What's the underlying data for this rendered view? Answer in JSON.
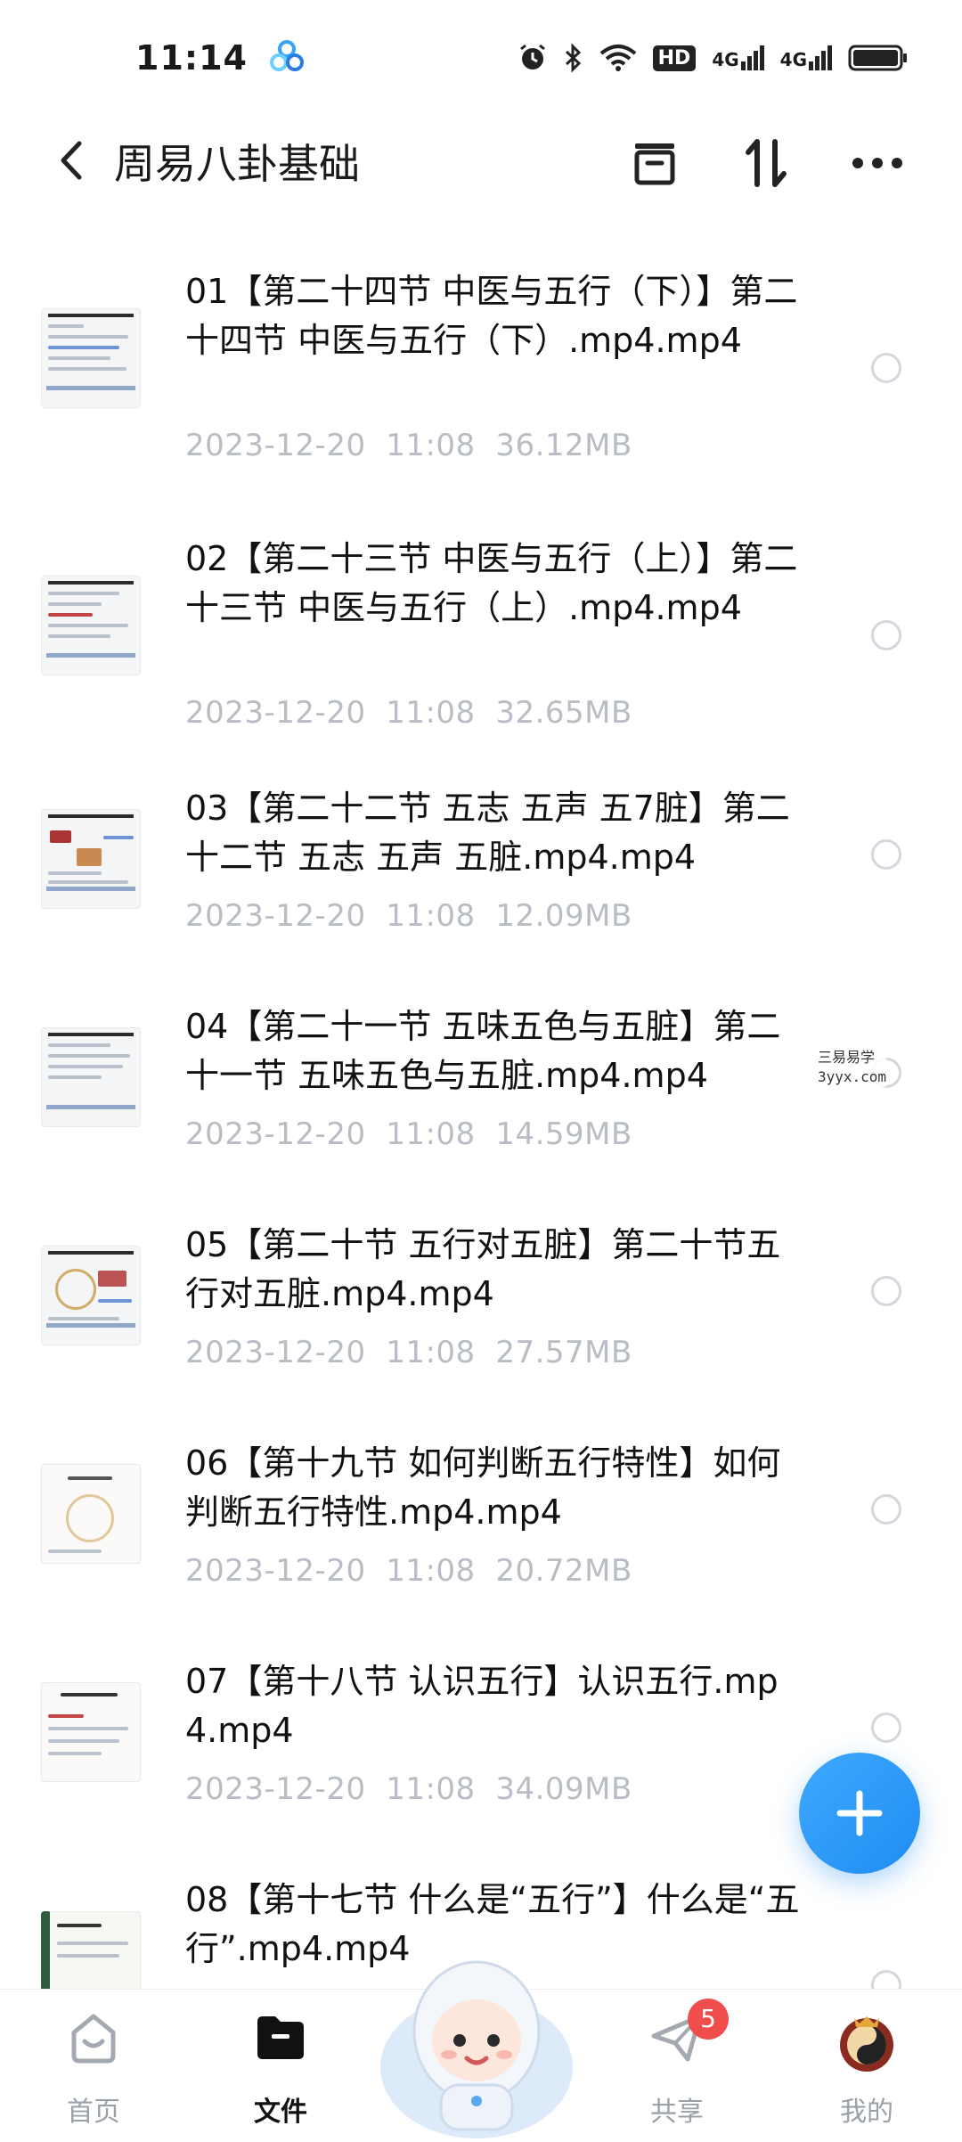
{
  "status_bar": {
    "time": "11:14",
    "signal_1": "4G",
    "signal_2": "4G",
    "hd_label": "HD"
  },
  "header": {
    "title": "周易八卦基础"
  },
  "files": [
    {
      "name": "01【第二十四节 中医与五行（下）】第二十四节 中医与五行（下）.mp4.mp4",
      "date": "2023-12-20  11:08",
      "size": "36.12MB"
    },
    {
      "name": "02【第二十三节 中医与五行（上）】第二十三节 中医与五行（上）.mp4.mp4",
      "date": "2023-12-20  11:08",
      "size": "32.65MB"
    },
    {
      "name": "03【第二十二节 五志 五声 五7脏】第二十二节 五志 五声 五脏.mp4.mp4",
      "date": "2023-12-20  11:08",
      "size": "12.09MB"
    },
    {
      "name": "04【第二十一节 五味五色与五脏】第二十一节 五味五色与五脏.mp4.mp4",
      "date": "2023-12-20  11:08",
      "size": "14.59MB"
    },
    {
      "name": "05【第二十节 五行对五脏】第二十节五行对五脏.mp4.mp4",
      "date": "2023-12-20  11:08",
      "size": "27.57MB"
    },
    {
      "name": "06【第十九节 如何判断五行特性】如何判断五行特性.mp4.mp4",
      "date": "2023-12-20  11:08",
      "size": "20.72MB"
    },
    {
      "name": "07【第十八节 认识五行】认识五行.mp4.mp4",
      "date": "2023-12-20  11:08",
      "size": "34.09MB"
    },
    {
      "name": "08【第十七节 什么是“五行”】什么是“五行”.mp4.mp4",
      "date": "",
      "size": ""
    }
  ],
  "watermark": {
    "line1": "三易易学",
    "line2": "3yyx.com"
  },
  "bottom_nav": {
    "home": "首页",
    "files": "文件",
    "share": "共享",
    "share_badge": "5",
    "mine": "我的"
  },
  "colors": {
    "accent": "#1f8cf2",
    "meta_text": "#b8bcc4",
    "badge": "#f04d4d"
  }
}
